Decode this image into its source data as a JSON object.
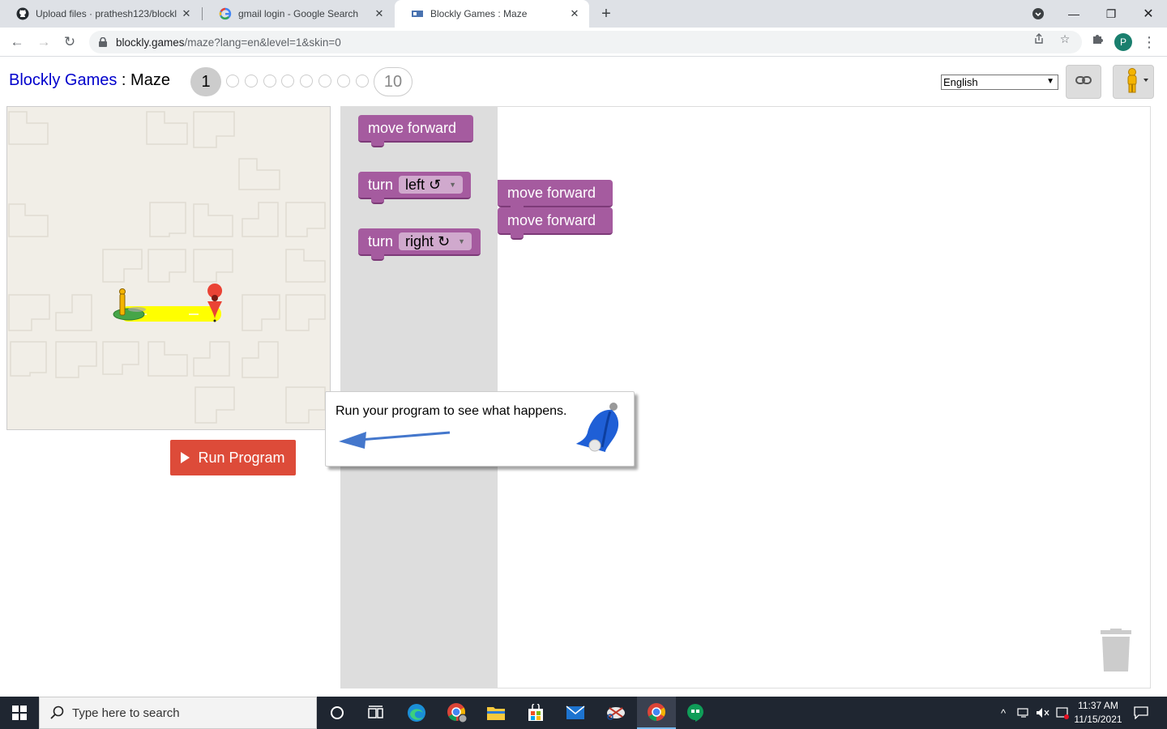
{
  "browser": {
    "tabs": [
      {
        "title": "Upload files · prathesh123/blockl",
        "favicon": "github-icon",
        "active": false
      },
      {
        "title": "gmail login - Google Search",
        "favicon": "google-icon",
        "active": false
      },
      {
        "title": "Blockly Games : Maze",
        "favicon": "blockly-icon",
        "active": true
      }
    ],
    "url_host": "blockly.games",
    "url_path": "/maze?lang=en&level=1&skin=0",
    "profile_initial": "P"
  },
  "header": {
    "site_name": "Blockly Games",
    "separator": " : ",
    "game_name": "Maze",
    "current_level": "1",
    "last_level": "10",
    "language": "English"
  },
  "maze": {
    "run_label": "Run Program"
  },
  "toolbox": {
    "blocks": [
      {
        "label": "move forward"
      },
      {
        "label": "turn",
        "dropdown": "left ↺"
      },
      {
        "label": "turn",
        "dropdown": "right ↻"
      }
    ]
  },
  "workspace": {
    "blocks": [
      "move forward",
      "move forward"
    ]
  },
  "hint": {
    "text": "Run your program to see what happens."
  },
  "taskbar": {
    "search_placeholder": "Type here to search",
    "time": "11:37 AM",
    "date": "11/15/2021"
  },
  "colors": {
    "block_purple": "#a55b9f",
    "run_button": "#dd4b39",
    "path_yellow": "#ffff00"
  }
}
